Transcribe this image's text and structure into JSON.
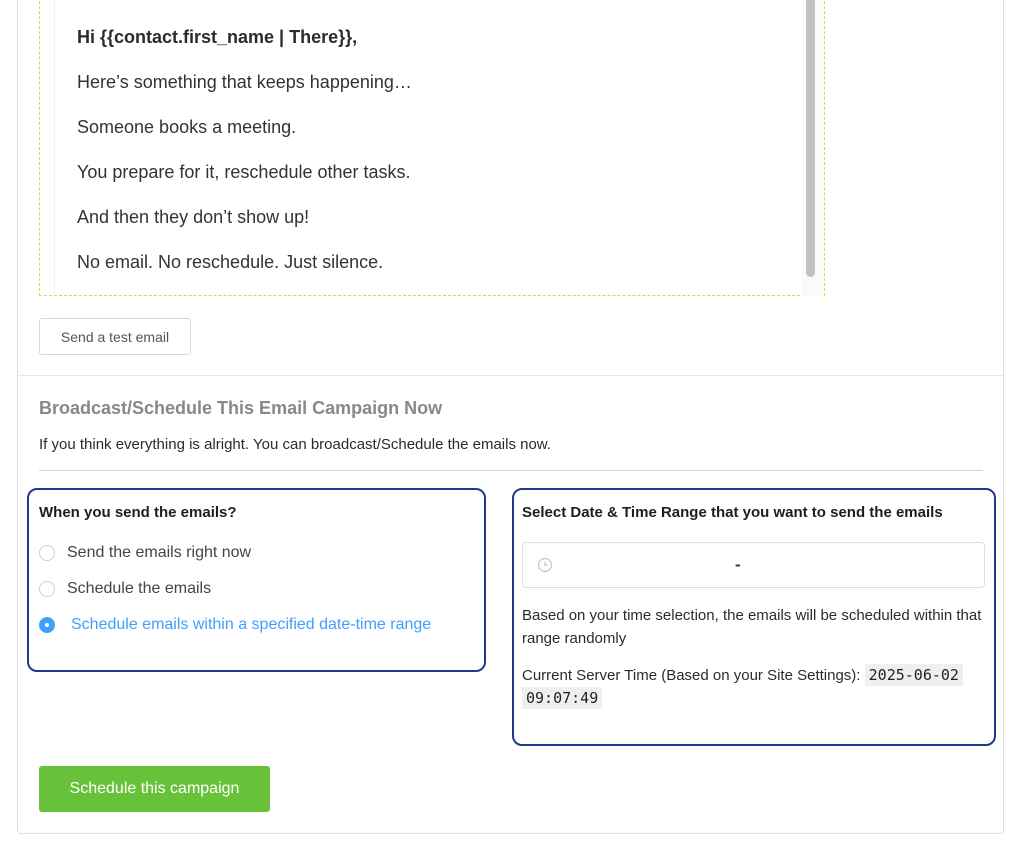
{
  "email_preview": {
    "greeting": "Hi {{contact.first_name | There}},",
    "lines": [
      "Here’s something that keeps happening…",
      "Someone books a meeting.",
      "You prepare for it, reschedule other tasks.",
      "And then they don’t show up!",
      "No email. No reschedule. Just silence."
    ]
  },
  "test_email_button": "Send a test email",
  "broadcast": {
    "title": "Broadcast/Schedule This Email Campaign Now",
    "description": "If you think everything is alright. You can broadcast/Schedule the emails now."
  },
  "send_options": {
    "heading": "When you send the emails?",
    "options": [
      {
        "label": "Send the emails right now",
        "selected": false
      },
      {
        "label": "Schedule the emails",
        "selected": false
      },
      {
        "label": "Schedule emails within a specified date-time range",
        "selected": true
      }
    ]
  },
  "date_range": {
    "heading": "Select Date & Time Range that you want to send the emails",
    "separator": "-",
    "icon": "clock-icon",
    "note": "Based on your time selection, the emails will be scheduled within that range randomly",
    "server_time_label": "Current Server Time (Based on your Site Settings):",
    "server_time_date": "2025-06-02",
    "server_time_time": "09:07:49"
  },
  "schedule_button": "Schedule this campaign",
  "colors": {
    "accent": "#409eff",
    "success": "#67c23a",
    "highlight_border": "#1e3a8a",
    "dashed_border": "#e6cf56"
  }
}
